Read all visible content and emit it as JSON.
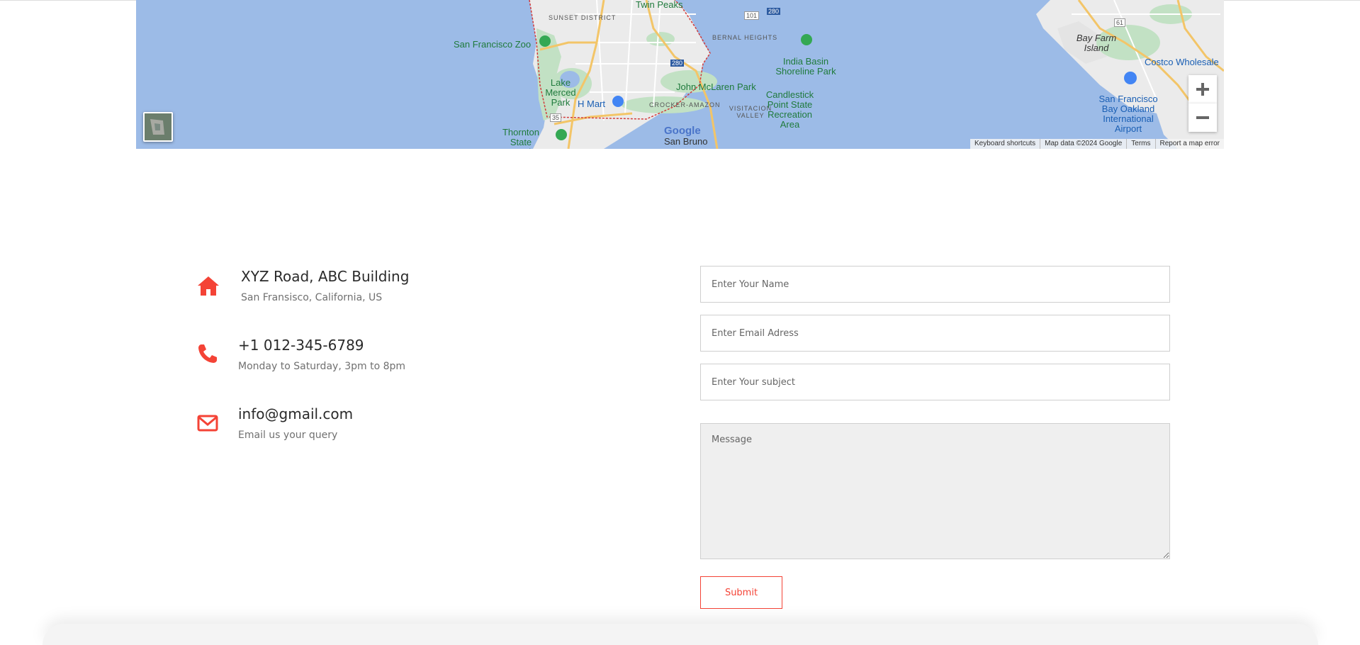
{
  "map": {
    "labels": {
      "twin_peaks": "Twin Peaks",
      "sunset_district": "SUNSET DISTRICT",
      "sf_zoo": "San Francisco Zoo",
      "bernal_heights": "BERNAL HEIGHTS",
      "india_basin": "India Basin Shoreline Park",
      "lake_merced": "Lake Merced Park",
      "h_mart": "H Mart",
      "john_mclaren": "John McLaren Park",
      "crocker_amazon": "CROCKER-AMAZON",
      "visitacion": "VISITACION VALLEY",
      "candlestick": "Candlestick Point State Recreation Area",
      "thornton": "Thornton State Beach",
      "san_bruno": "San Bruno",
      "bay_farm": "Bay Farm Island",
      "costco": "Costco Wholesale",
      "sfo_oakland": "San Francisco Bay Oakland International Airport",
      "hwy_101": "101",
      "hwy_280a": "280",
      "hwy_280b": "280",
      "hwy_35": "35",
      "hwy_61": "61"
    },
    "google_logo": "Google",
    "attribution": {
      "keyboard": "Keyboard shortcuts",
      "map_data": "Map data ©2024 Google",
      "terms": "Terms",
      "report": "Report a map error"
    },
    "controls": {
      "zoom_in": "+",
      "zoom_out": "−"
    },
    "colors": {
      "water": "#9cbbe7",
      "land": "#ebebeb",
      "park": "#c2e1c4",
      "highway": "#f3c568",
      "boundary": "#d23b3b"
    }
  },
  "contact": {
    "address": {
      "icon": "home-icon",
      "title": "XYZ Road, ABC Building",
      "subtitle": "San Fransisco, California, US"
    },
    "phone": {
      "icon": "phone-icon",
      "title": "+1 012-345-6789",
      "subtitle": "Monday to Saturday, 3pm to 8pm"
    },
    "email": {
      "icon": "envelope-icon",
      "title": "info@gmail.com",
      "subtitle": "Email us your query"
    }
  },
  "form": {
    "name_placeholder": "Enter Your Name",
    "email_placeholder": "Enter Email Adress",
    "subject_placeholder": "Enter Your subject",
    "message_placeholder": "Message",
    "submit_label": "Submit"
  },
  "colors": {
    "accent": "#f44336"
  }
}
